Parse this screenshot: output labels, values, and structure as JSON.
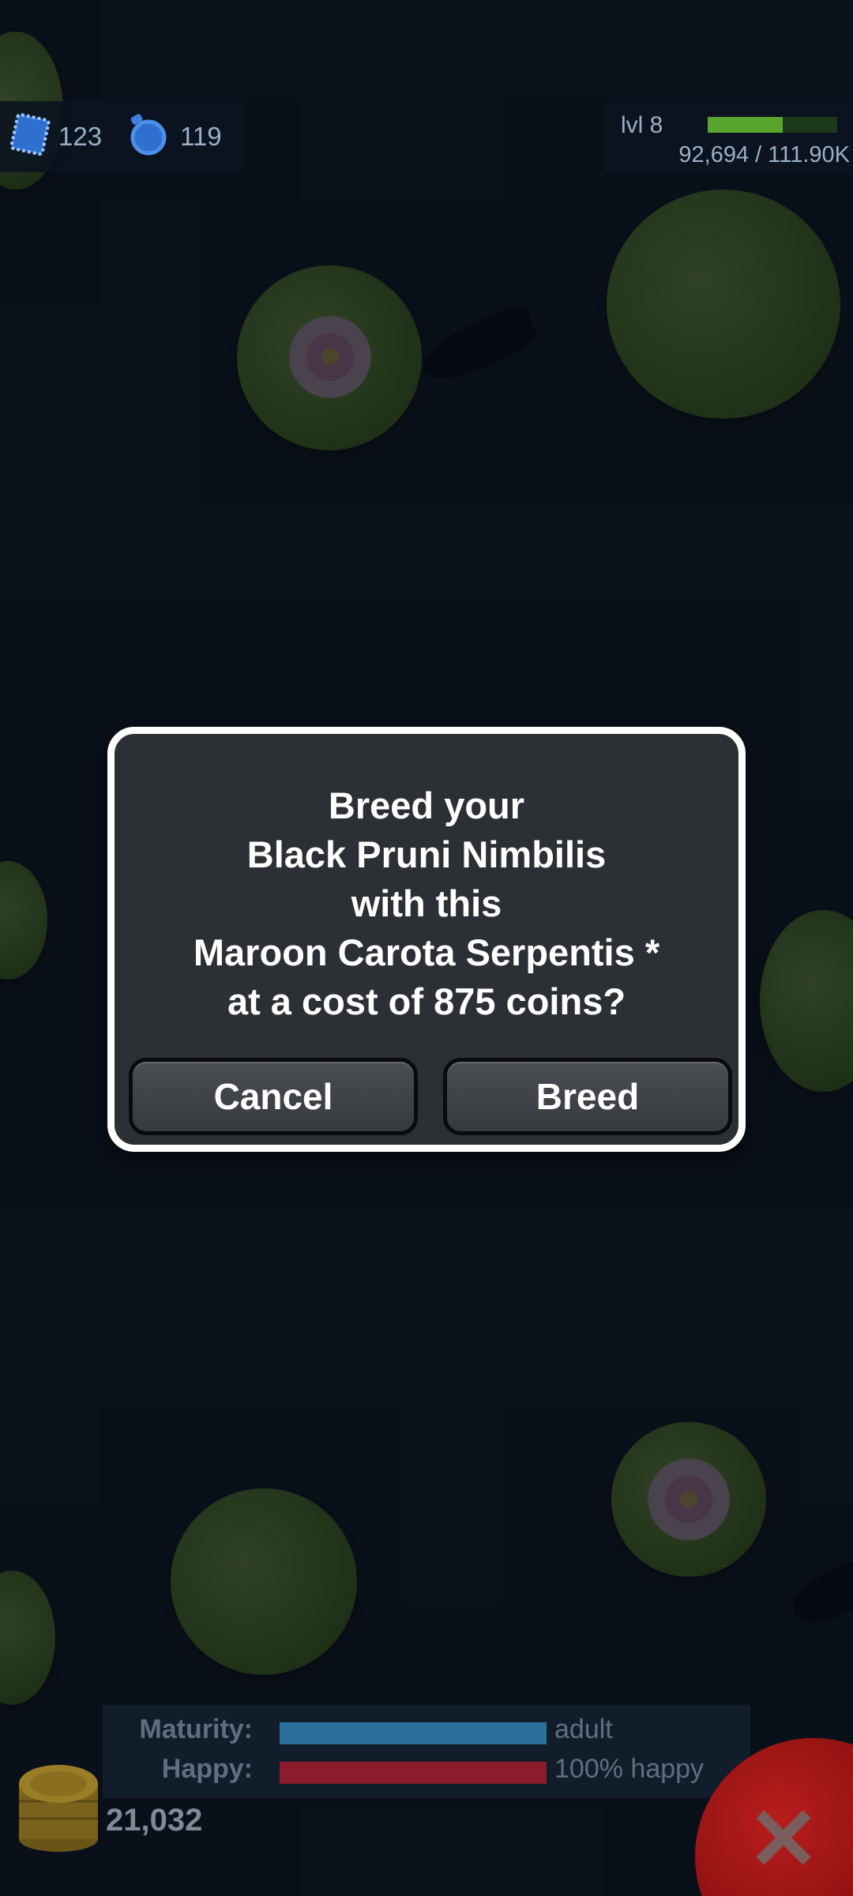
{
  "hud": {
    "stamps_count": "123",
    "potions_count": "119",
    "level_label": "lvl 8",
    "xp_text": "92,694 / 111.90K",
    "xp_fraction": 0.58
  },
  "dialog": {
    "lines": [
      "Breed your",
      "Black Pruni Nimbilis",
      "with this",
      "Maroon Carota Serpentis *",
      "at a cost of 875 coins?"
    ],
    "cancel_label": "Cancel",
    "breed_label": "Breed"
  },
  "status": {
    "maturity_label": "Maturity:",
    "maturity_value": "adult",
    "maturity_fraction": 1.0,
    "maturity_color": "#2b6f9a",
    "happy_label": "Happy:",
    "happy_value": "100% happy",
    "happy_fraction": 1.0,
    "happy_color": "#8a1c2b"
  },
  "coins": {
    "amount": "21,032"
  },
  "colors": {
    "pond": "#17222e",
    "dialog_bg": "#2c2f33",
    "dialog_border": "#ffffff"
  }
}
